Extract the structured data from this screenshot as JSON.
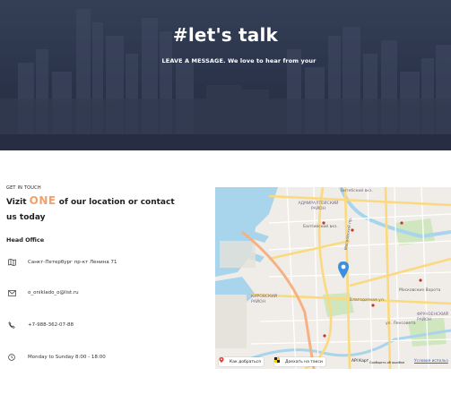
{
  "hero": {
    "title": "#let's talk",
    "subtitle": "LEAVE A MESSAGE. We love to hear from your"
  },
  "contact": {
    "eyebrow": "GET IN TOUCH",
    "heading_prefix": "Vizit",
    "heading_accent": "ONE",
    "heading_suffix": "of our location or contact us today",
    "office_title": "Head Office",
    "items": [
      {
        "icon": "map-icon",
        "text": "Санкт-Петербург пр-кт Ленина 71"
      },
      {
        "icon": "mail-icon",
        "text": "o_oniklado_o@list.ru"
      },
      {
        "icon": "phone-icon",
        "text": "+7-988-362-07-88"
      },
      {
        "icon": "clock-icon",
        "text": "Monday to Sunday 8:00 - 18:00"
      }
    ]
  },
  "map": {
    "labels": {
      "vitebsk": "Витебский вкз.",
      "admiralteysky": "АДМИРАЛТЕЙСКИЙ РАЙОН",
      "baltic": "Балтийский вкз.",
      "kirovsky": "КИРОВСКИЙ РАЙОН",
      "moskovsky": "Московский пр.",
      "blagodatnaya": "Благодатная ул.",
      "frunze": "ФРУНЗЕНСКИЙ РАЙОН",
      "moscow_vorota": "Московские Ворота",
      "lensoveta": "ул. Ленсовета"
    },
    "route_button": "Как добраться",
    "taxi_button": "Доехать на такси",
    "api_label": "API Карт",
    "report_label": "Сообщить об ошибке",
    "terms_label": "Условия использ"
  },
  "colors": {
    "accent": "#f2a06a",
    "hero_bg": "#2d3850",
    "map_road": "#fbd97f",
    "map_pin": "#3b8fe0"
  }
}
